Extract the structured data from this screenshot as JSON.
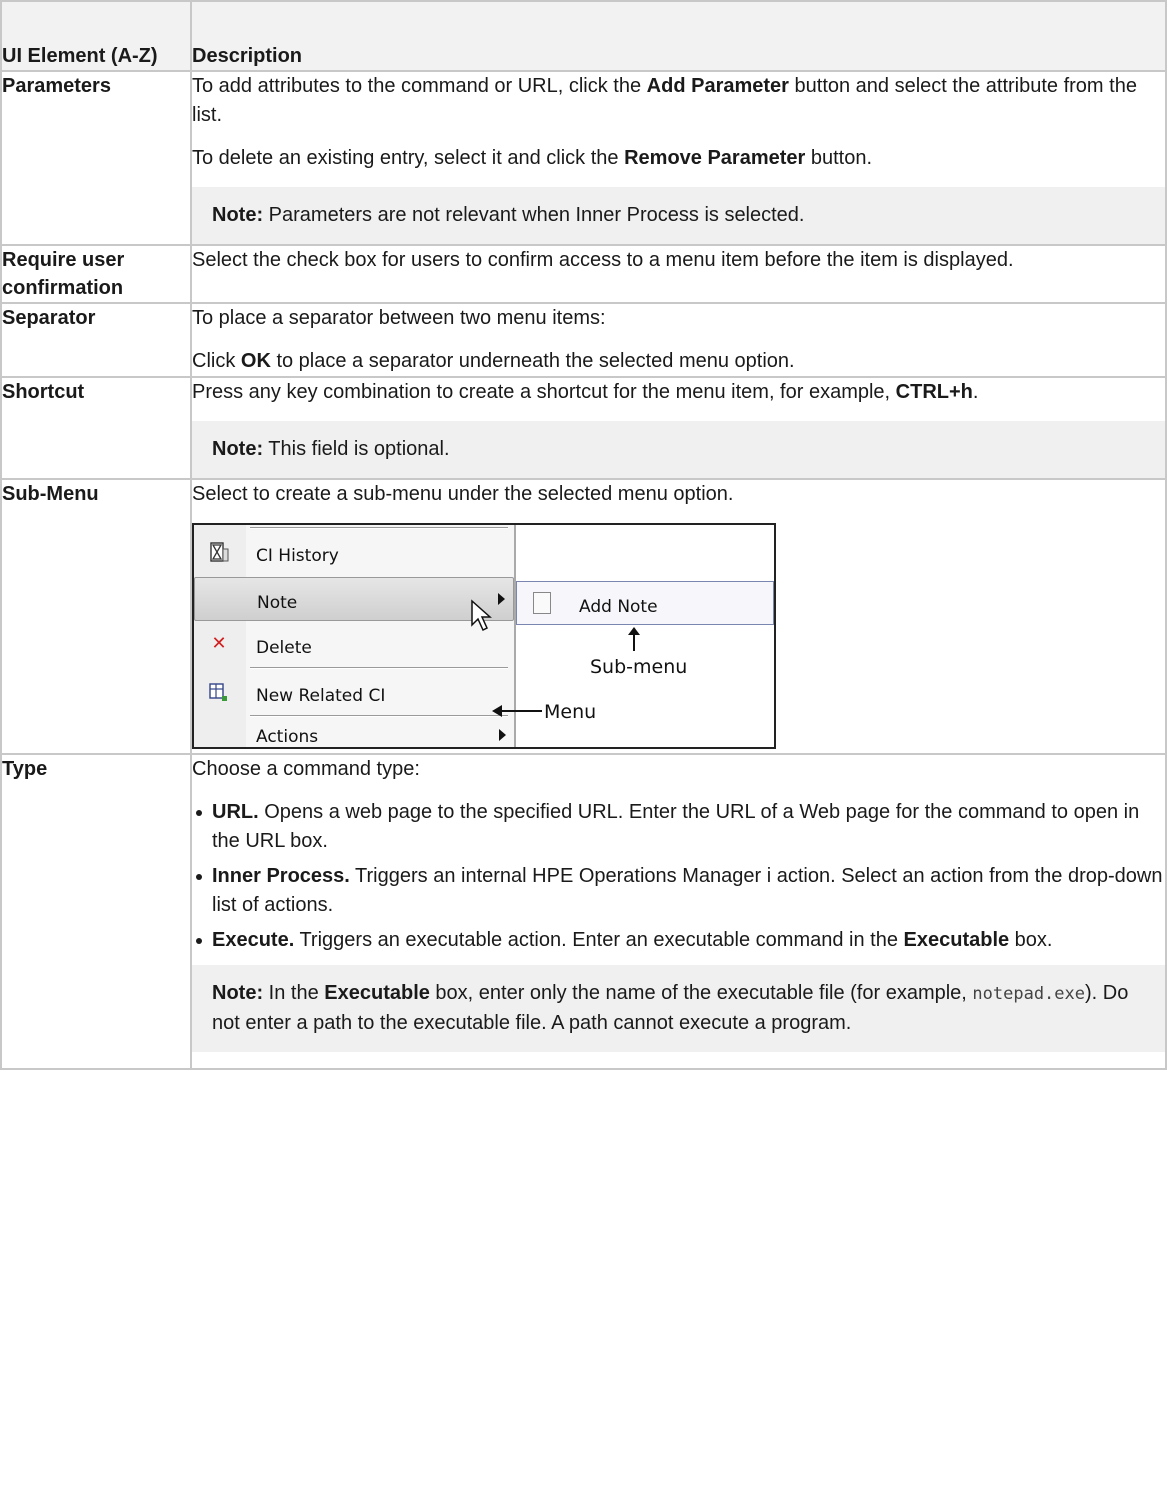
{
  "table": {
    "header": {
      "col1": "UI Element (A-Z)",
      "col2": "Description"
    },
    "rows": {
      "parameters": {
        "name": "Parameters",
        "p1_a": "To add attributes to the command or URL, click the ",
        "p1_b": "Add Parameter",
        "p1_c": " button and select the attribute from the list.",
        "p2_a": "To delete an existing entry, select it and click the ",
        "p2_b": "Remove Parameter",
        "p2_c": " button.",
        "note_label": "Note:",
        "note_text": " Parameters are not relevant when Inner Process is selected."
      },
      "require": {
        "name": "Require user confirmation",
        "text": "Select the check box for users to confirm access to a menu item before the item is displayed."
      },
      "separator": {
        "name": "Separator",
        "p1": "To place a separator between two menu items:",
        "p2_a": "Click ",
        "p2_b": "OK",
        "p2_c": " to place a separator underneath the selected menu option."
      },
      "shortcut": {
        "name": "Shortcut",
        "p1_a": "Press any key combination to create a shortcut for the menu item, for example, ",
        "p1_b": "CTRL+h",
        "p1_c": ".",
        "note_label": "Note:",
        "note_text": " This field is optional."
      },
      "submenu": {
        "name": "Sub-Menu",
        "text": "Select to create a sub-menu under the selected menu option.",
        "figure": {
          "menu_items": [
            "CI History",
            "Note",
            "Delete",
            "New Related CI",
            "Actions"
          ],
          "submenu_item": "Add Note",
          "label_submenu": "Sub-menu",
          "label_menu": "Menu",
          "icons": [
            "hourglass-icon",
            "delete-x-icon",
            "new-ci-icon",
            "document-icon"
          ]
        }
      },
      "type": {
        "name": "Type",
        "intro": "Choose a command type:",
        "bullets": [
          {
            "term": "URL.",
            "text": " Opens a web page to the specified URL. Enter the URL of a Web page for the command to open in the URL box."
          },
          {
            "term": "Inner Process.",
            "text": " Triggers an internal HPE Operations Manager i action. Select an action from the drop-down list of actions."
          },
          {
            "term": "Execute.",
            "text": " Triggers an executable action. Enter an executable command in the ",
            "term2": "Executable",
            "text2": " box."
          }
        ],
        "note_label": "Note:",
        "note_a": " In the ",
        "note_b": "Executable",
        "note_c": " box, enter only the name of the executable file (for example, ",
        "note_code": "notepad.exe",
        "note_d": "). Do not enter a path to the executable file. A path cannot execute a program."
      }
    }
  },
  "colors": {
    "border": "#c8c8c8",
    "header_bg": "#f2f2f2",
    "note_bg": "#f0f0f0"
  }
}
